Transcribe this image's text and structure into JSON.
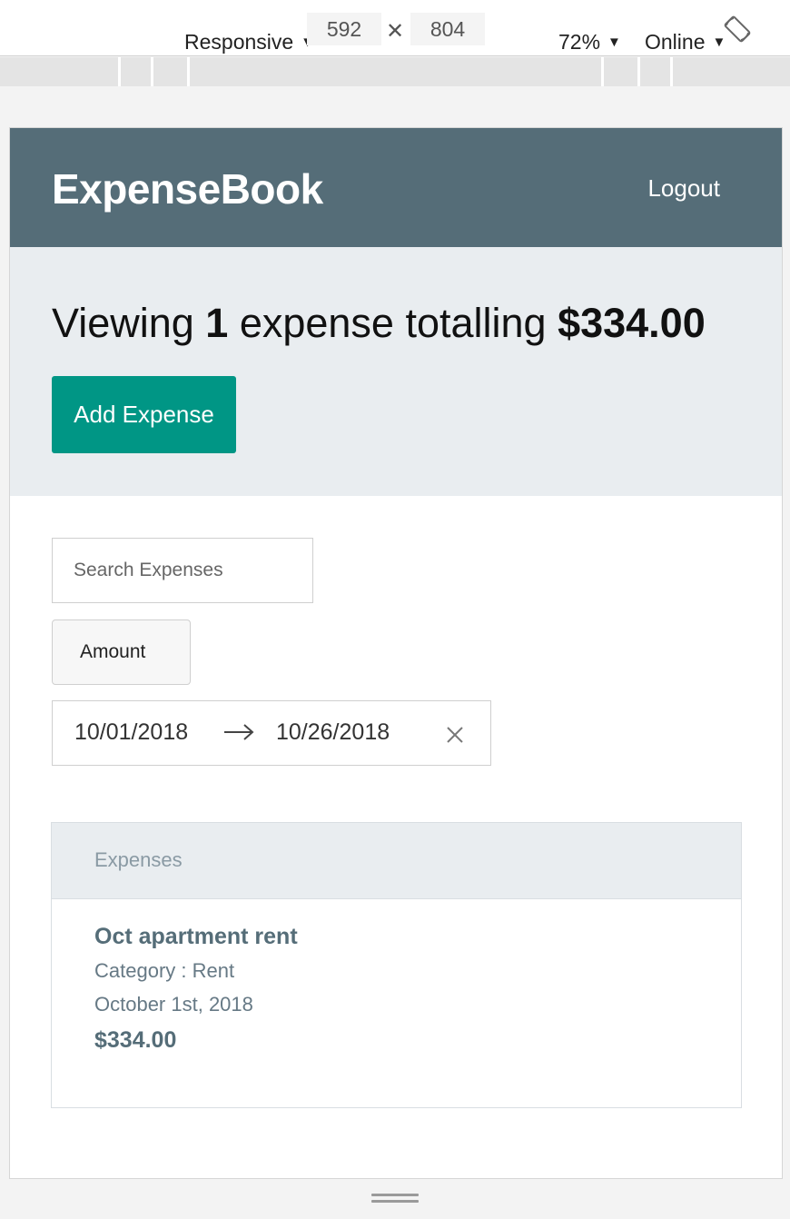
{
  "devtools": {
    "device": "Responsive",
    "width": "592",
    "height": "804",
    "zoom": "72%",
    "network": "Online"
  },
  "app": {
    "brand": "ExpenseBook",
    "logout_label": "Logout"
  },
  "summary": {
    "prefix": "Viewing ",
    "count": "1",
    "middle": " expense totalling ",
    "total": "$334.00",
    "add_label": "Add Expense"
  },
  "filters": {
    "search_placeholder": "Search Expenses",
    "sort_value": "Amount",
    "start_date": "10/01/2018",
    "end_date": "10/26/2018"
  },
  "expenses": {
    "header": "Expenses",
    "items": [
      {
        "title": "Oct apartment rent",
        "category": "Category : Rent",
        "date": "October 1st, 2018",
        "amount": "$334.00"
      }
    ]
  }
}
